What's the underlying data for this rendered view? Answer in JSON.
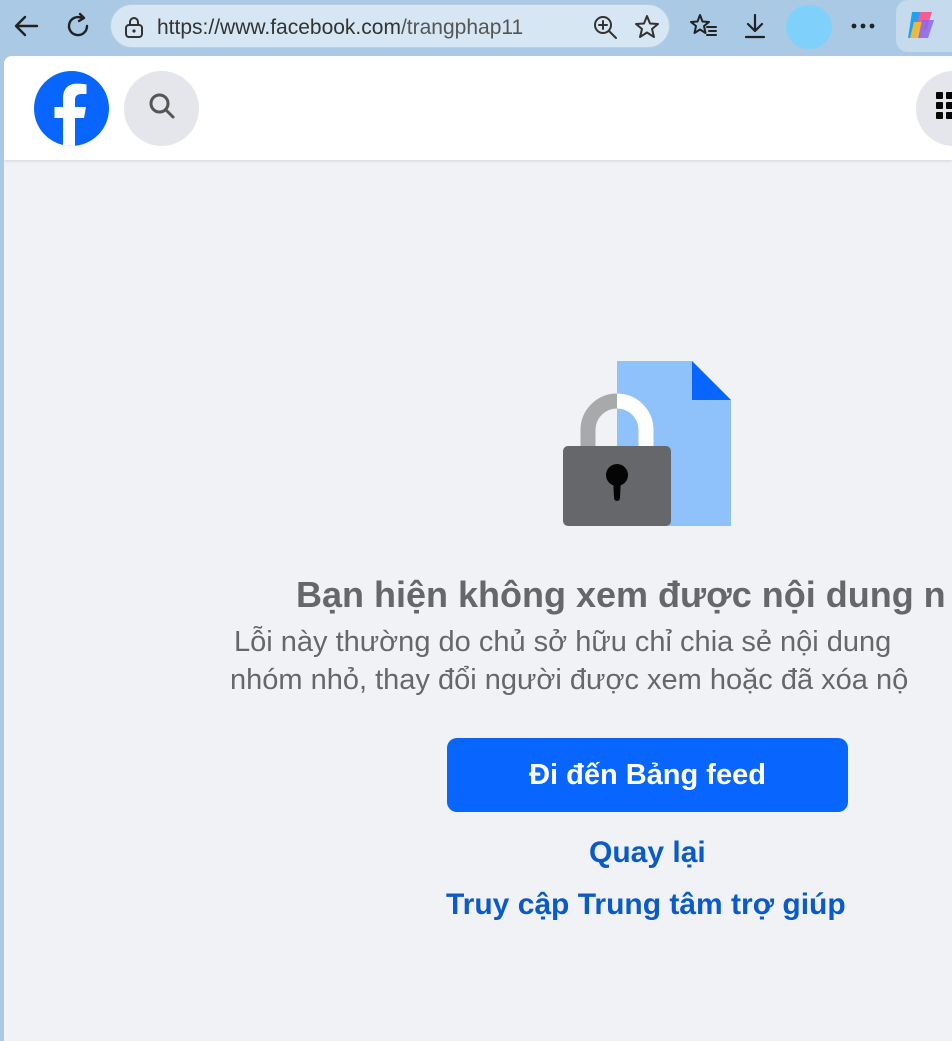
{
  "browser": {
    "url_host": "https://www.facebook.com",
    "url_path": "/trangphap11"
  },
  "content": {
    "title": "Bạn hiện không xem được nội dung n",
    "description_line1": "Lỗi này thường do chủ sở hữu chỉ chia sẻ nội dung",
    "description_line2": "nhóm nhỏ, thay đổi người được xem hoặc đã xóa nộ",
    "primary_button": "Đi đến Bảng feed",
    "back_link": "Quay lại",
    "help_link": "Truy cập Trung tâm trợ giúp"
  },
  "colors": {
    "brand": "#0866ff",
    "page_bg": "#f0f2f5",
    "link": "#0a5bc9",
    "muted_text": "#65676b"
  },
  "icons": {
    "back": "arrow-left-icon",
    "reload": "reload-icon",
    "lock": "lock-icon",
    "zoom": "zoom-in-icon",
    "favorite": "star-icon",
    "favorites_list": "favorites-icon",
    "download": "download-icon",
    "more": "more-icon",
    "copilot": "copilot-icon",
    "facebook": "facebook-logo-icon",
    "search": "search-icon",
    "menu": "menu-grid-icon",
    "illustration": "locked-document-icon"
  }
}
